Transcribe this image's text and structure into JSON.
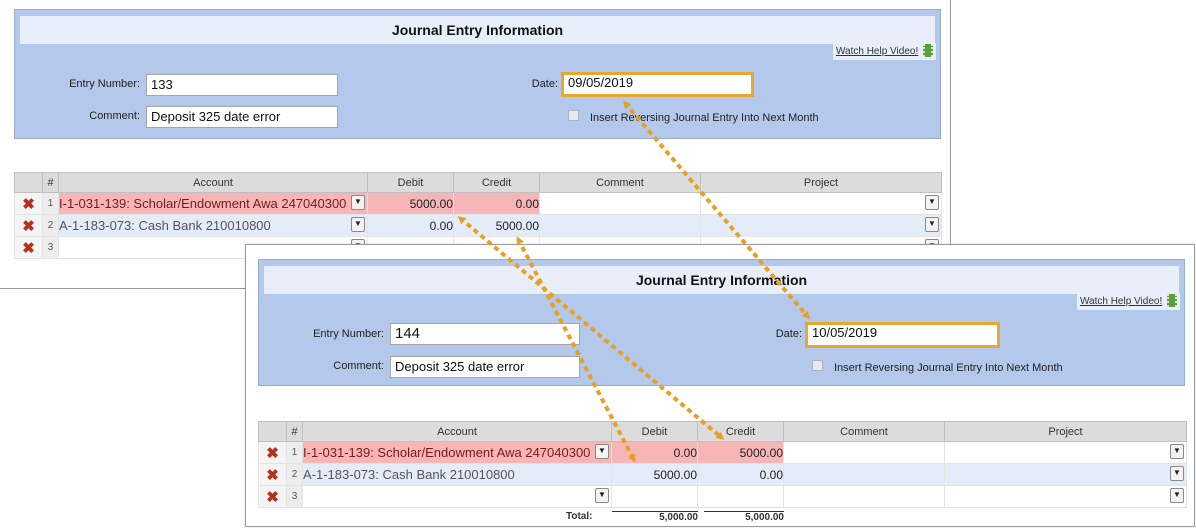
{
  "windows": [
    {
      "title": "Journal Entry Information",
      "help_link": "Watch Help Video!",
      "entry_number_label": "Entry Number:",
      "entry_number": "133",
      "comment_label": "Comment:",
      "comment": "Deposit 325 date error",
      "date_label": "Date:",
      "date": "09/05/2019",
      "reversing_label": "Insert Reversing Journal Entry Into Next Month",
      "columns": [
        "#",
        "Account",
        "Debit",
        "Credit",
        "Comment",
        "Project"
      ],
      "rows": [
        {
          "num": "1",
          "account": "I-1-031-139: Scholar/Endowment Awa 247040300",
          "debit": "5000.00",
          "credit": "0.00"
        },
        {
          "num": "2",
          "account": "A-1-183-073: Cash Bank 210010800",
          "debit": "0.00",
          "credit": "5000.00"
        },
        {
          "num": "3",
          "account": "",
          "debit": "",
          "credit": ""
        }
      ]
    },
    {
      "title": "Journal Entry Information",
      "help_link": "Watch Help Video!",
      "entry_number_label": "Entry Number:",
      "entry_number": "144",
      "comment_label": "Comment:",
      "comment": "Deposit 325 date error",
      "date_label": "Date:",
      "date": "10/05/2019",
      "reversing_label": "Insert Reversing Journal Entry Into Next Month",
      "columns": [
        "#",
        "Account",
        "Debit",
        "Credit",
        "Comment",
        "Project"
      ],
      "rows": [
        {
          "num": "1",
          "account": "I-1-031-139: Scholar/Endowment Awa 247040300",
          "debit": "0.00",
          "credit": "5000.00"
        },
        {
          "num": "2",
          "account": "A-1-183-073: Cash Bank 210010800",
          "debit": "5000.00",
          "credit": "0.00"
        },
        {
          "num": "3",
          "account": "",
          "debit": "",
          "credit": ""
        }
      ],
      "total_label": "Total:",
      "total_debit": "5,000.00",
      "total_credit": "5,000.00"
    }
  ],
  "icons": {
    "delete": "delete-x-icon",
    "dropdown": "chevron-down-icon",
    "help_video": "film-icon"
  },
  "colors": {
    "panel": "#b3c8ea",
    "highlight_border": "#e8a830",
    "error_row": "#f6b6b7",
    "arrow": "#e8a020"
  }
}
